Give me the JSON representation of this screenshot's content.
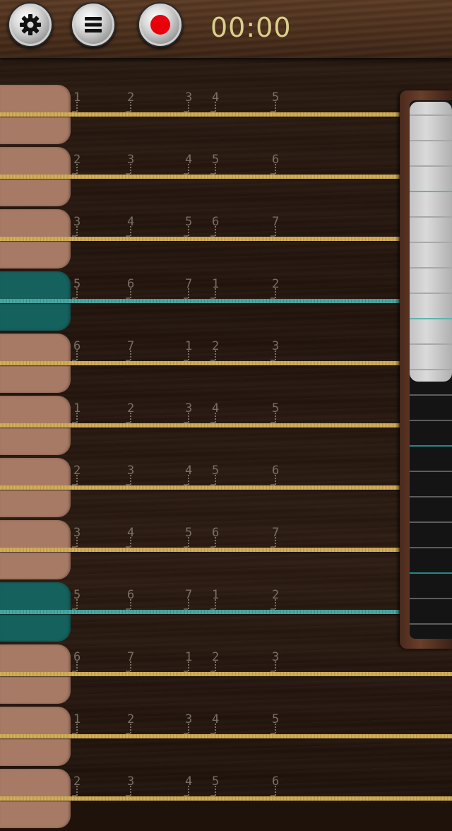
{
  "toolbar": {
    "settings_icon": "gear-icon",
    "menu_icon": "menu-icon",
    "record_icon": "record-icon",
    "record_color": "#e8000a",
    "timer": "00:00"
  },
  "colors": {
    "tab": "#a77a65",
    "tab_accent": "#15615d",
    "string": "#d4b25a",
    "string_accent": "#3aa19c"
  },
  "strings": [
    {
      "accent": false,
      "notes": [
        "1",
        "2",
        "3",
        "4",
        "5"
      ]
    },
    {
      "accent": false,
      "notes": [
        "2",
        "3",
        "4",
        "5",
        "6"
      ]
    },
    {
      "accent": false,
      "notes": [
        "3",
        "4",
        "5",
        "6",
        "7"
      ]
    },
    {
      "accent": true,
      "notes": [
        "5",
        "6",
        "7",
        "1",
        "2"
      ]
    },
    {
      "accent": false,
      "notes": [
        "6",
        "7",
        "1",
        "2",
        "3"
      ]
    },
    {
      "accent": false,
      "notes": [
        "1",
        "2",
        "3",
        "4",
        "5"
      ]
    },
    {
      "accent": false,
      "notes": [
        "2",
        "3",
        "4",
        "5",
        "6"
      ]
    },
    {
      "accent": false,
      "notes": [
        "3",
        "4",
        "5",
        "6",
        "7"
      ]
    },
    {
      "accent": true,
      "notes": [
        "5",
        "6",
        "7",
        "1",
        "2"
      ]
    },
    {
      "accent": false,
      "notes": [
        "6",
        "7",
        "1",
        "2",
        "3"
      ]
    },
    {
      "accent": false,
      "notes": [
        "1",
        "2",
        "3",
        "4",
        "5"
      ]
    },
    {
      "accent": false,
      "notes": [
        "2",
        "3",
        "4",
        "5",
        "6"
      ]
    }
  ],
  "scroller": {
    "visible_fraction": 0.52,
    "lines": 21,
    "accent_lines": [
      3,
      8,
      13,
      18
    ]
  }
}
